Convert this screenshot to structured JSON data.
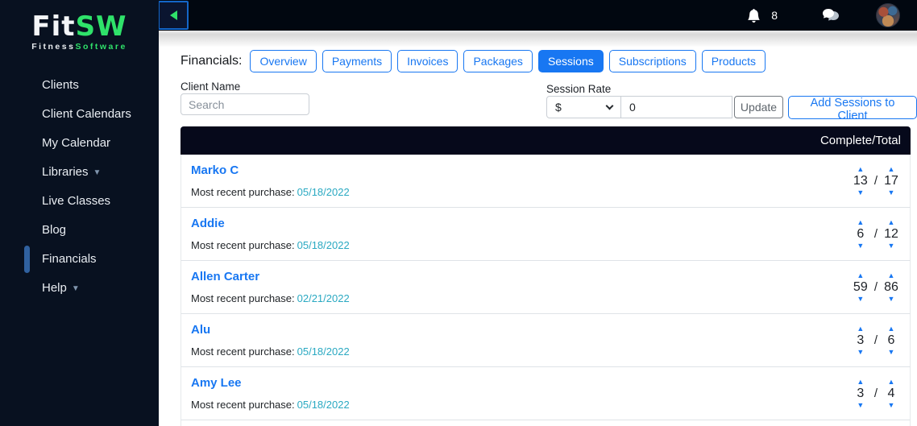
{
  "colors": {
    "accent_blue": "#1877f2",
    "teal_link": "#2aa9c2",
    "brand_green": "#2fe26a",
    "sidebar_bg": "#081120",
    "table_header_bg": "#06091b"
  },
  "sidebar": {
    "logo": {
      "fit": "Fit",
      "sw": "SW",
      "tag_fitness": "Fitness",
      "tag_software": "Software"
    },
    "items": [
      {
        "label": "Clients"
      },
      {
        "label": "Client Calendars"
      },
      {
        "label": "My Calendar"
      },
      {
        "label": "Libraries"
      },
      {
        "label": "Live Classes"
      },
      {
        "label": "Blog"
      },
      {
        "label": "Financials"
      },
      {
        "label": "Help"
      }
    ]
  },
  "topbar": {
    "notification_count": "8"
  },
  "financials": {
    "label": "Financials:",
    "tabs": [
      {
        "label": "Overview"
      },
      {
        "label": "Payments"
      },
      {
        "label": "Invoices"
      },
      {
        "label": "Packages"
      },
      {
        "label": "Sessions"
      },
      {
        "label": "Subscriptions"
      },
      {
        "label": "Products"
      }
    ]
  },
  "filters": {
    "client_name_label": "Client Name",
    "search_placeholder": "Search",
    "session_rate_label": "Session Rate",
    "currency": "$",
    "rate_value": "0",
    "update_label": "Update",
    "add_sessions_label": "Add Sessions to Client"
  },
  "table": {
    "header": "Complete/Total",
    "purchase_label": "Most recent purchase:",
    "rows": [
      {
        "name": "Marko C",
        "date": "05/18/2022",
        "complete": "13",
        "total": "17"
      },
      {
        "name": "Addie",
        "date": "05/18/2022",
        "complete": "6",
        "total": "12"
      },
      {
        "name": "Allen Carter",
        "date": "02/21/2022",
        "complete": "59",
        "total": "86"
      },
      {
        "name": "Alu",
        "date": "05/18/2022",
        "complete": "3",
        "total": "6"
      },
      {
        "name": "Amy Lee",
        "date": "05/18/2022",
        "complete": "3",
        "total": "4"
      }
    ]
  }
}
